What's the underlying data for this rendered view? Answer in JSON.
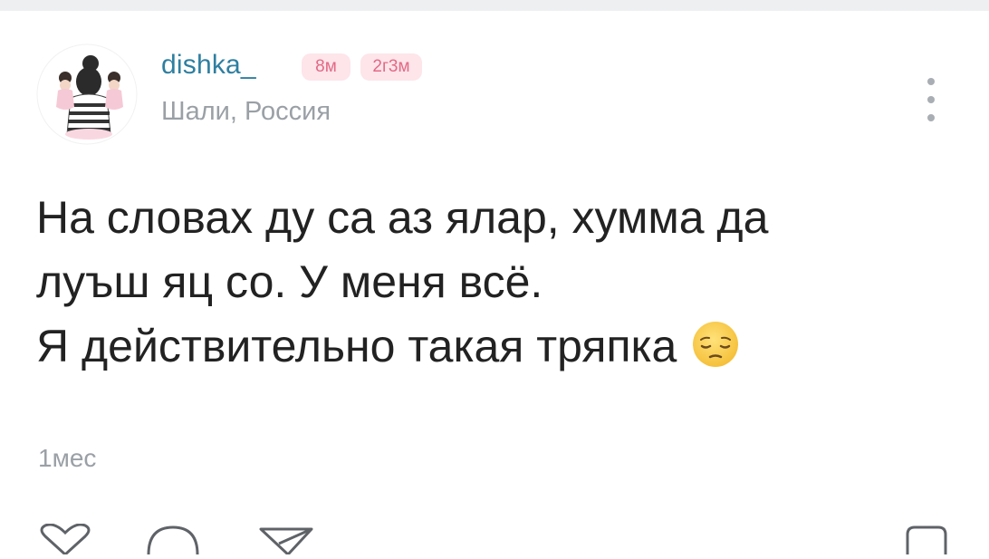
{
  "post": {
    "author": {
      "username": "dishka_",
      "location": "Шали, Россия",
      "badges": [
        "8м",
        "2г3м"
      ]
    },
    "text_lines": [
      "На словах ду са аз ялар, хумма да",
      "луъш яц со. У меня всё.",
      "Я действительно такая тряпка"
    ],
    "emoji": "pensive-face-icon",
    "timestamp": "1мес",
    "actions": [
      "like-icon",
      "comment-icon",
      "share-icon",
      "bookmark-icon"
    ]
  },
  "colors": {
    "username": "#2e7fa0",
    "badge_bg": "#fde5ea",
    "badge_text": "#e26a86",
    "muted": "#9aa0a6",
    "body_text": "#222222"
  }
}
